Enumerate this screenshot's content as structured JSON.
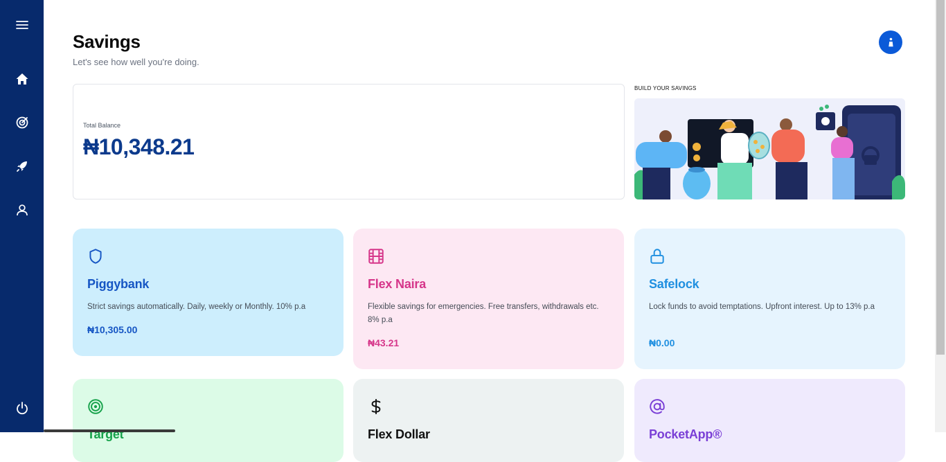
{
  "sidebar": {
    "items": [
      {
        "icon": "menu-icon"
      },
      {
        "icon": "home-icon"
      },
      {
        "icon": "target-icon"
      },
      {
        "icon": "rocket-icon"
      },
      {
        "icon": "user-icon"
      },
      {
        "icon": "power-icon"
      }
    ]
  },
  "header": {
    "title": "Savings",
    "subtitle": "Let's see how well you're doing."
  },
  "balance": {
    "label": "Total Balance",
    "value": "₦10,348.21"
  },
  "promo": {
    "title": "BUILD YOUR SAVINGS"
  },
  "plans": [
    {
      "name": "Piggybank",
      "description": "Strict savings automatically. Daily, weekly or Monthly. 10% p.a",
      "amount": "₦10,305.00",
      "color": "#1656c4",
      "bg": "#cdeefd",
      "icon": "shield-icon"
    },
    {
      "name": "Flex Naira",
      "description": "Flexible savings for emergencies. Free transfers, withdrawals etc. 8% p.a",
      "amount": "₦43.21",
      "color": "#d6368a",
      "bg": "#fde8f3",
      "icon": "film-icon"
    },
    {
      "name": "Safelock",
      "description": "Lock funds to avoid temptations. Upfront interest. Up to 13% p.a",
      "amount": "₦0.00",
      "color": "#1f8fe0",
      "bg": "#e6f4fe",
      "icon": "lock-icon"
    },
    {
      "name": "Target",
      "color": "#17a24b",
      "bg": "#dcfbe7",
      "icon": "target-icon"
    },
    {
      "name": "Flex Dollar",
      "color": "#111111",
      "bg": "#edf2f2",
      "icon": "dollar-icon"
    },
    {
      "name": "PocketApp®",
      "color": "#7a3fd6",
      "bg": "#efeafd",
      "icon": "at-icon"
    }
  ]
}
